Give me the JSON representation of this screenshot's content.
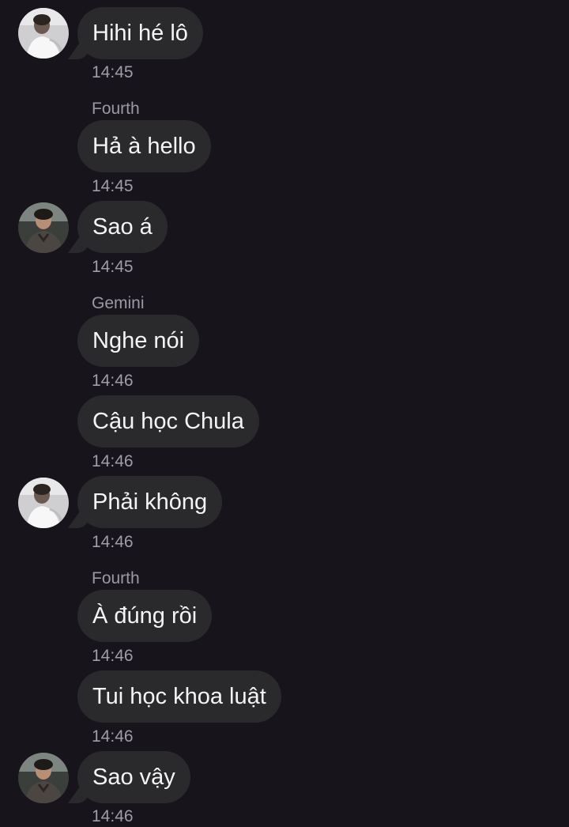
{
  "chat": {
    "messages": [
      {
        "sender": "",
        "text": "Hihi hé lô",
        "time": "14:45",
        "avatar": "avatar-light-icon"
      },
      {
        "sender": "Fourth",
        "text": "Hả à hello",
        "time": "14:45",
        "avatar": ""
      },
      {
        "sender": "",
        "text": "Sao á",
        "time": "14:45",
        "avatar": "avatar-dark-icon"
      },
      {
        "sender": "Gemini",
        "text": "Nghe nói",
        "time": "14:46",
        "avatar": ""
      },
      {
        "sender": "",
        "text": "Cậu học Chula",
        "time": "14:46",
        "avatar": ""
      },
      {
        "sender": "",
        "text": "Phải không",
        "time": "14:46",
        "avatar": "avatar-light-icon"
      },
      {
        "sender": "Fourth",
        "text": "À đúng rồi",
        "time": "14:46",
        "avatar": ""
      },
      {
        "sender": "",
        "text": "Tui học khoa luật",
        "time": "14:46",
        "avatar": ""
      },
      {
        "sender": "",
        "text": "Sao vậy",
        "time": "14:46",
        "avatar": "avatar-dark-icon"
      }
    ]
  },
  "colors": {
    "background": "#17141c",
    "bubble": "#2a2a2d",
    "text": "#f4f4f4",
    "meta": "#9d99a4"
  }
}
